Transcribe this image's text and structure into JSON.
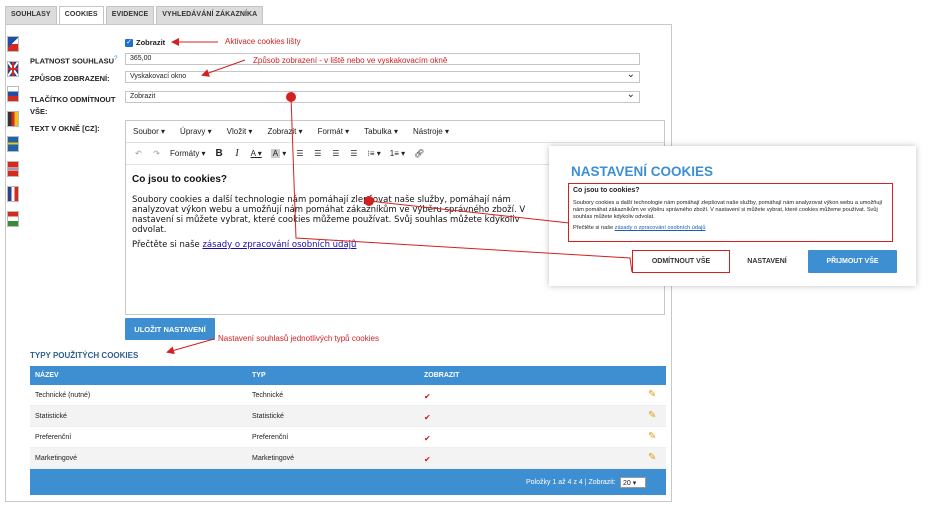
{
  "tabs": [
    "SOUHLASY",
    "COOKIES",
    "EVIDENCE",
    "VYHLEDÁVÁNÍ ZÁKAZNÍKA"
  ],
  "form": {
    "show_checkbox_label": "Zobrazit",
    "validity_label": "PLATNOST SOUHLASU",
    "validity_help": "?",
    "validity_value": "365,00",
    "display_mode_label": "ZPŮSOB ZOBRAZENÍ:",
    "display_mode_value": "Vyskakovací okno",
    "reject_label_1": "TLAČÍTKO ODMÍTNOUT",
    "reject_label_2": "VŠE:",
    "reject_value": "Zobrazit",
    "text_label": "TEXT V OKNĚ [CZ]:"
  },
  "notes": {
    "activation": "Aktivace cookies lišty",
    "display_mode": "Způsob zobrazení - v liště nebo ve vyskakovacím okně",
    "types": "Nastavení souhlasů jednotlivých typů cookies"
  },
  "editor": {
    "menu": [
      "Soubor ▾",
      "Úpravy ▾",
      "Vložit ▾",
      "Zobrazit ▾",
      "Formát ▾",
      "Tabulka ▾",
      "Nástroje ▾"
    ],
    "formats_label": "Formáty ▾",
    "heading": "Co jsou to cookies?",
    "paragraph": "Soubory cookies a další technologie nám pomáhají zlepšovat naše služby, pomáhají nám analyzovat výkon webu a umožňují nám pomáhat zákazníkům ve výběru správného zboží. V nastavení si můžete vybrat, které cookies můžeme používat. Svůj souhlas můžete kdykoliv odvolat.",
    "link_prefix": "Přečtěte si naše ",
    "link_text": "zásady o zpracování osobních údajů"
  },
  "save_button": "ULOŽIT NASTAVENÍ",
  "types_title": "TYPY POUŽITÝCH COOKIES",
  "table": {
    "headers": [
      "NÁZEV",
      "TYP",
      "ZOBRAZIT"
    ],
    "rows": [
      {
        "name": "Technické (nutné)",
        "type": "Technické",
        "show": "✔"
      },
      {
        "name": "Statistické",
        "type": "Statistické",
        "show": "✔"
      },
      {
        "name": "Preferenční",
        "type": "Preferenční",
        "show": "✔"
      },
      {
        "name": "Marketingové",
        "type": "Marketingové",
        "show": "✔"
      }
    ],
    "footer_text": "Položky 1 až 4 z 4 | Zobrazit:",
    "page_size": "20"
  },
  "popup": {
    "title": "NASTAVENÍ COOKIES",
    "heading": "Co jsou to cookies?",
    "text": "Soubory cookies a další technologie nám pomáhají zlepšovat naše služby, pomáhají nám analyzovat výkon webu a umožňují nám pomáhat zákazníkům ve výběru správného zboží. V nastavení si můžete vybrat, které cookies můžeme používat. Svůj souhlas můžete kdykoliv odvolat.",
    "link_prefix": "Přečtěte si naše ",
    "link_text": "zásady o zpracování osobních údajů",
    "reject_button": "ODMÍTNOUT VŠE",
    "settings_button": "NASTAVENÍ",
    "accept_button": "PŘIJMOUT VŠE"
  },
  "colors": {
    "accent": "#3d8fd1",
    "annotation": "#d42020",
    "check": "#cc1a1a",
    "pencil": "#e39a1b"
  },
  "icons": [
    "edit-pencil-icon",
    "checkmark-icon",
    "undo-icon",
    "redo-icon",
    "bold-icon",
    "italic-icon",
    "link-icon",
    "flag-icons"
  ]
}
